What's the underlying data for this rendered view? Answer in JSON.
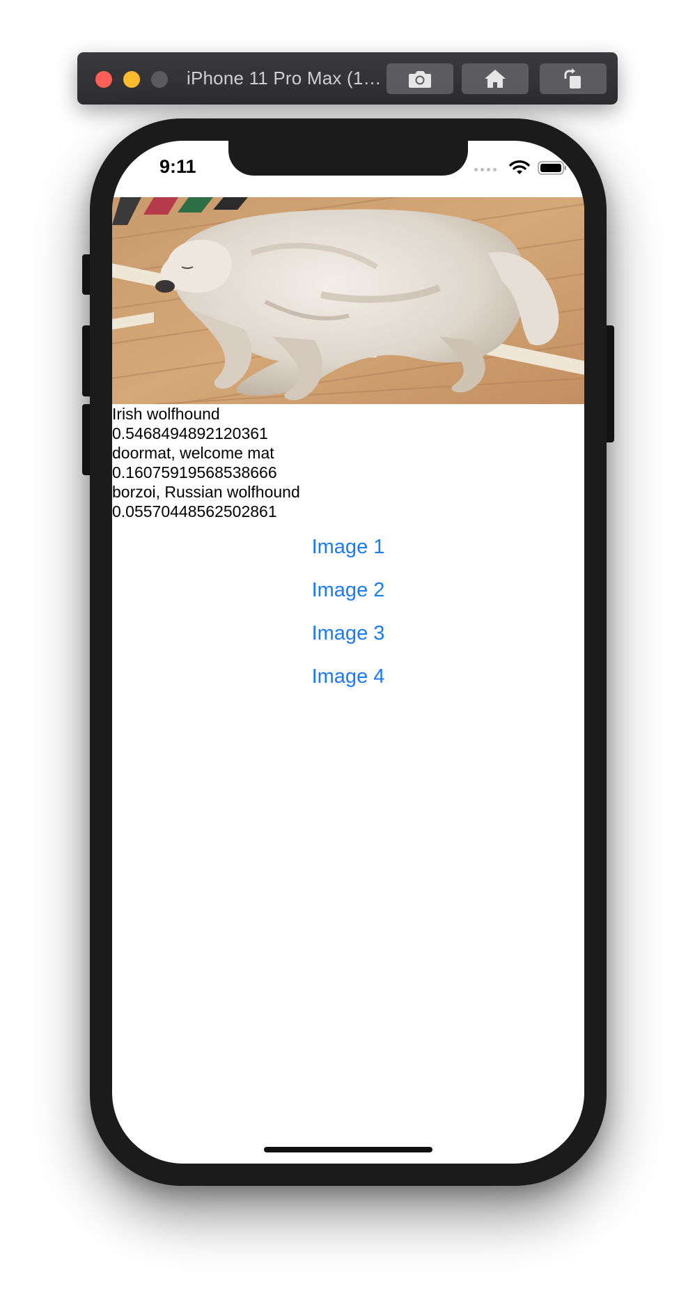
{
  "simulator": {
    "title": "iPhone 11 Pro Max (1…",
    "screenshot_button_icon": "camera-icon",
    "home_button_icon": "home-icon",
    "rotate_button_icon": "rotate-icon"
  },
  "status_bar": {
    "time": "9:11",
    "signal_icon": "signal-dots-icon",
    "wifi_icon": "wifi-icon",
    "battery_icon": "battery-icon"
  },
  "photo": {
    "description_icon": "dog-photo"
  },
  "predictions": [
    {
      "label": "Irish wolfhound",
      "score": "0.5468494892120361"
    },
    {
      "label": "doormat, welcome mat",
      "score": "0.16075919568538666"
    },
    {
      "label": "borzoi, Russian wolfhound",
      "score": "0.05570448562502861"
    }
  ],
  "buttons": [
    {
      "label": "Image 1"
    },
    {
      "label": "Image 2"
    },
    {
      "label": "Image 3"
    },
    {
      "label": "Image 4"
    }
  ],
  "colors": {
    "link_blue": "#1a7cf5",
    "traffic_close": "#fe5f57",
    "traffic_minimize": "#febc2e",
    "phone_frame": "#1b1b1c"
  }
}
